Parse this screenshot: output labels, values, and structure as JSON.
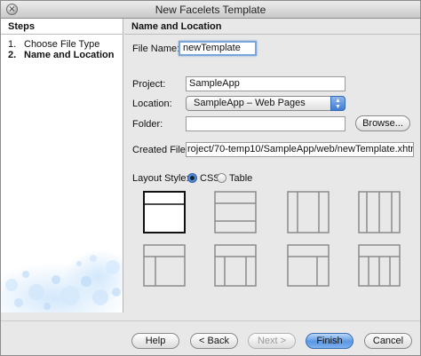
{
  "window": {
    "title": "New Facelets Template"
  },
  "steps": {
    "heading": "Steps",
    "items": [
      {
        "num": "1.",
        "label": "Choose File Type"
      },
      {
        "num": "2.",
        "label": "Name and Location"
      }
    ]
  },
  "panel": {
    "heading": "Name and Location",
    "file_name_label": "File Name:",
    "file_name_value": "newTemplate",
    "project_label": "Project:",
    "project_value": "SampleApp",
    "location_label": "Location:",
    "location_value": "SampleApp – Web Pages",
    "folder_label": "Folder:",
    "folder_value": "",
    "browse_label": "Browse...",
    "created_file_label": "Created File:",
    "created_file_value": "roject/70-temp10/SampleApp/web/newTemplate.xhtml",
    "layout_style_label": "Layout Style:",
    "layout_options": [
      {
        "label": "CSS",
        "selected": true
      },
      {
        "label": "Table",
        "selected": false
      }
    ],
    "layouts": [
      "header-content",
      "header-footer",
      "left-sidebar",
      "three-columns",
      "header-left-sidebar",
      "header-three-columns",
      "header-right-sidebar",
      "header-two-sidebars"
    ],
    "selected_layout": 0
  },
  "buttons": {
    "help": "Help",
    "back": "< Back",
    "next": "Next >",
    "finish": "Finish",
    "cancel": "Cancel"
  },
  "colors": {
    "accent": "#3b79d0",
    "focus": "#7aa5d9"
  }
}
